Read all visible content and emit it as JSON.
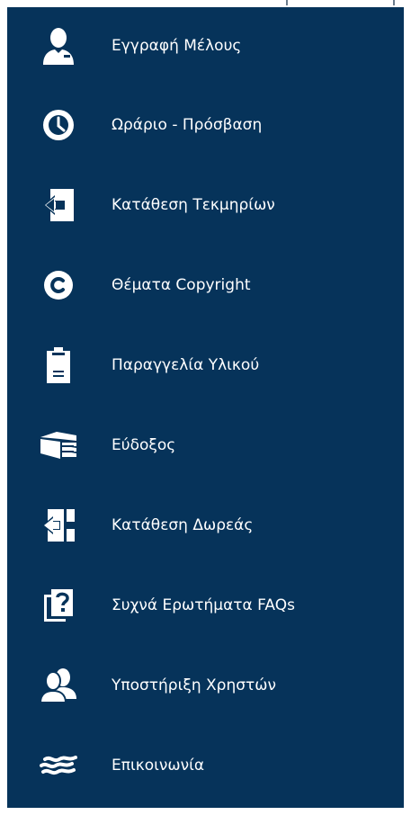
{
  "menu": {
    "items": [
      {
        "label": "Εγγραφή Μέλους",
        "icon": "user-icon"
      },
      {
        "label": "Ωράριο - Πρόσβαση",
        "icon": "clock-icon"
      },
      {
        "label": "Κατάθεση Τεκμηρίων",
        "icon": "deposit-arrow-icon"
      },
      {
        "label": "Θέματα Copyright",
        "icon": "copyright-icon"
      },
      {
        "label": "Παραγγελία Υλικού",
        "icon": "clipboard-icon"
      },
      {
        "label": "Εύδοξος",
        "icon": "books-icon"
      },
      {
        "label": "Κατάθεση Δωρεάς",
        "icon": "donation-arrow-icon"
      },
      {
        "label": "Συχνά Ερωτήματα FAQs",
        "icon": "faq-icon"
      },
      {
        "label": "Υποστήριξη Χρηστών",
        "icon": "users-support-icon"
      },
      {
        "label": "Επικοινωνία",
        "icon": "waves-icon"
      }
    ]
  },
  "colors": {
    "menu_background": "#06335a",
    "text": "#ffffff",
    "icon": "#ffffff"
  }
}
